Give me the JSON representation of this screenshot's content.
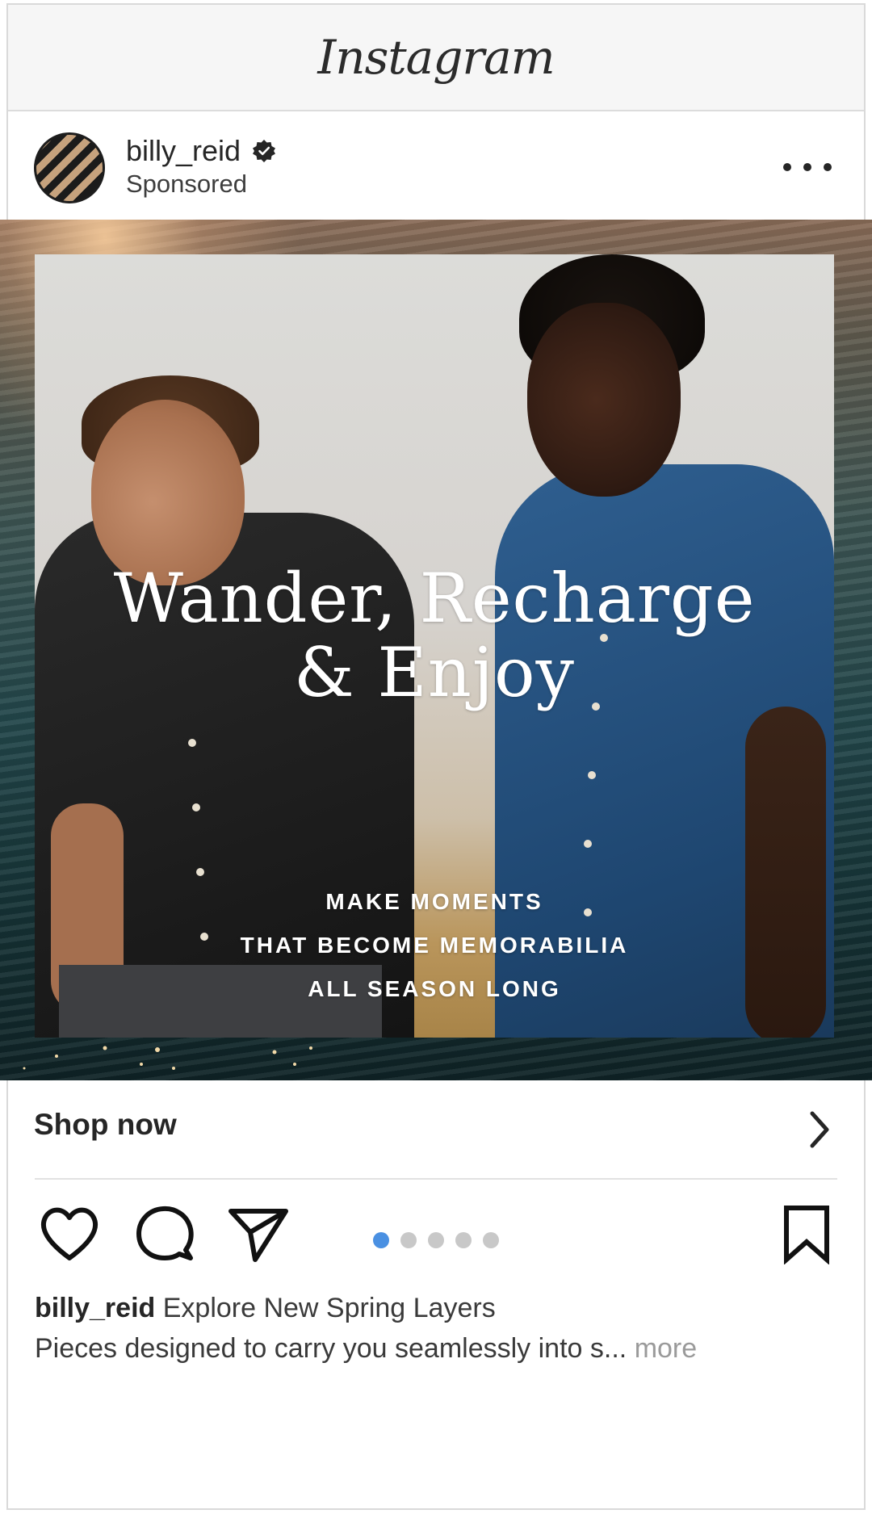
{
  "app": {
    "title": "Instagram"
  },
  "post": {
    "username": "billy_reid",
    "sponsored_label": "Sponsored",
    "headline_line1": "Wander, Recharge",
    "headline_line2": "& Enjoy",
    "tagline_line1": "MAKE MOMENTS",
    "tagline_line2": "THAT BECOME MEMORABILIA",
    "tagline_line3": "ALL SEASON LONG",
    "cta_label": "Shop now",
    "carousel_count": 5,
    "carousel_active": 1,
    "caption_title": "Explore New Spring Layers",
    "caption_text": "Pieces designed to carry you seamlessly into s...",
    "more_label": "more"
  },
  "colors": {
    "carousel_active": "#4a90e2",
    "carousel_inactive": "#c8c8c8",
    "text_primary": "#262626"
  },
  "icons": [
    "verified-badge-icon",
    "more-options-icon",
    "chevron-right-icon",
    "heart-icon",
    "comment-icon",
    "share-icon",
    "bookmark-icon"
  ]
}
